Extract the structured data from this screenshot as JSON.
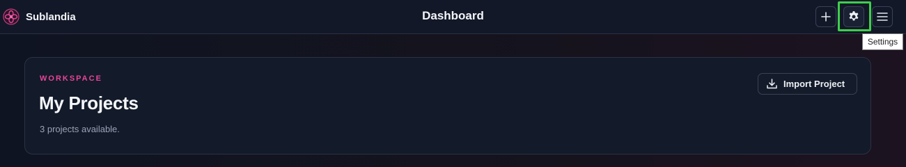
{
  "app": {
    "name": "Sublandia",
    "logo_icon": "flower-logo-icon",
    "accent_color": "#e8449a"
  },
  "header": {
    "title": "Dashboard",
    "actions": [
      {
        "id": "add",
        "icon": "plus-icon",
        "label": "Add"
      },
      {
        "id": "settings",
        "icon": "gear-icon",
        "label": "Settings",
        "focused": true
      },
      {
        "id": "menu",
        "icon": "hamburger-menu-icon",
        "label": "Menu"
      }
    ],
    "tooltip": "Settings",
    "focus_color": "#3fcf4c"
  },
  "workspace": {
    "eyebrow": "WORKSPACE",
    "title": "My Projects",
    "subtitle": "3 projects available.",
    "import_button": {
      "label": "Import Project",
      "icon": "download-icon"
    }
  }
}
